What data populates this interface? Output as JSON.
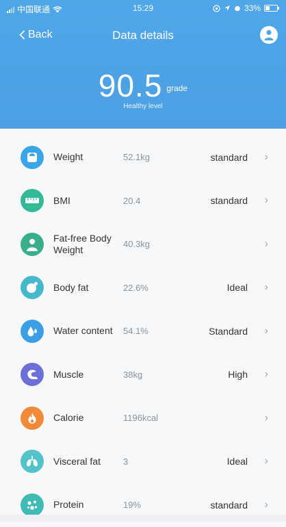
{
  "status_bar": {
    "carrier": "中国联通",
    "time": "15:29",
    "battery": "33%"
  },
  "header": {
    "back_label": "Back",
    "title": "Data details",
    "score_value": "90.5",
    "score_unit": "grade",
    "score_level": "Healthy level"
  },
  "colors": {
    "header_blue": "#4fa7e8",
    "weight": "#3aa6e8",
    "bmi": "#35b897",
    "fatfree": "#3aad8c",
    "bodyfat": "#46b8cc",
    "water": "#3c9fe6",
    "muscle": "#6d6fd8",
    "calorie": "#f08a3a",
    "visceral": "#52c4c9",
    "protein": "#3fbab4"
  },
  "metrics": [
    {
      "label": "Weight",
      "value": "52.1kg",
      "status": "standard",
      "icon": "scale-icon"
    },
    {
      "label": "BMI",
      "value": "20.4",
      "status": "standard",
      "icon": "ruler-icon"
    },
    {
      "label": "Fat-free Body Weight",
      "value": "40.3kg",
      "status": "",
      "icon": "person-icon"
    },
    {
      "label": "Body fat",
      "value": "22.6%",
      "status": "Ideal",
      "icon": "drop-circle-icon"
    },
    {
      "label": "Water content",
      "value": "54.1%",
      "status": "Standard",
      "icon": "water-drop-icon"
    },
    {
      "label": "Muscle",
      "value": "38kg",
      "status": "High",
      "icon": "muscle-arm-icon"
    },
    {
      "label": "Calorie",
      "value": "1196kcal",
      "status": "",
      "icon": "flame-icon"
    },
    {
      "label": "Visceral fat",
      "value": "3",
      "status": "Ideal",
      "icon": "lungs-icon"
    },
    {
      "label": "Protein",
      "value": "19%",
      "status": "standard",
      "icon": "molecule-icon"
    }
  ]
}
